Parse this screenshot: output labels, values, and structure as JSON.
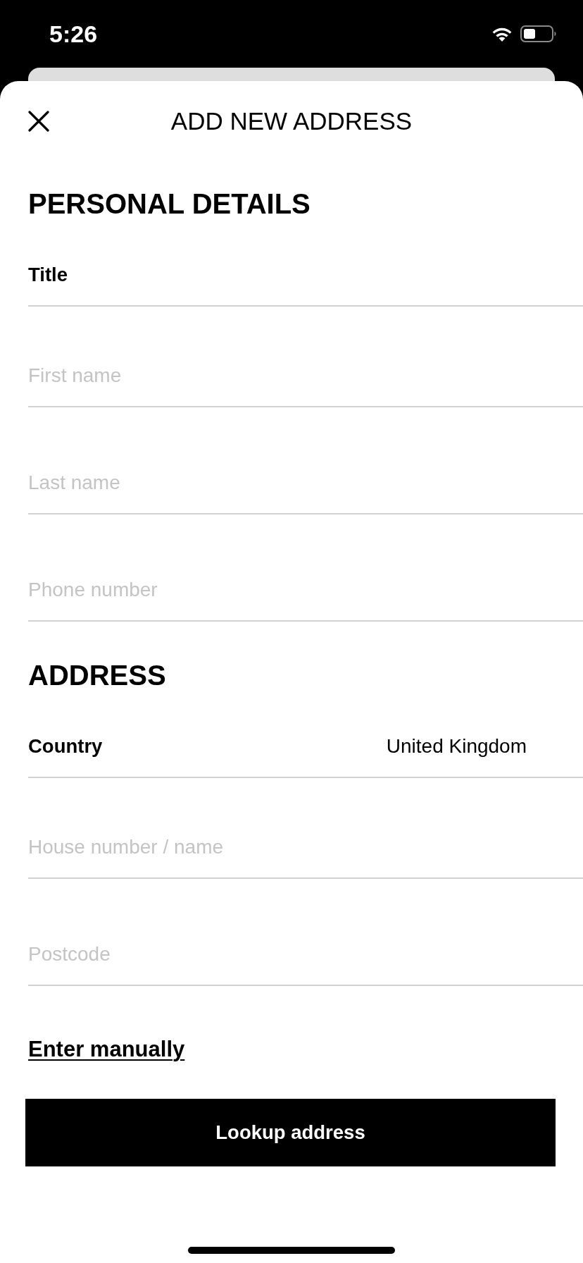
{
  "status_bar": {
    "time": "5:26"
  },
  "sheet": {
    "title": "ADD NEW ADDRESS"
  },
  "sections": [
    {
      "heading": "PERSONAL DETAILS",
      "fields": [
        {
          "kind": "select",
          "label": "Title"
        },
        {
          "kind": "text",
          "placeholder": "First name"
        },
        {
          "kind": "text",
          "placeholder": "Last name"
        },
        {
          "kind": "text",
          "placeholder": "Phone number"
        }
      ]
    },
    {
      "heading": "ADDRESS",
      "fields": [
        {
          "kind": "select",
          "label": "Country",
          "value": "United Kingdom"
        },
        {
          "kind": "text",
          "placeholder": "House number / name"
        },
        {
          "kind": "text",
          "placeholder": "Postcode"
        }
      ]
    }
  ],
  "link": "Enter manually",
  "button": "Lookup address"
}
